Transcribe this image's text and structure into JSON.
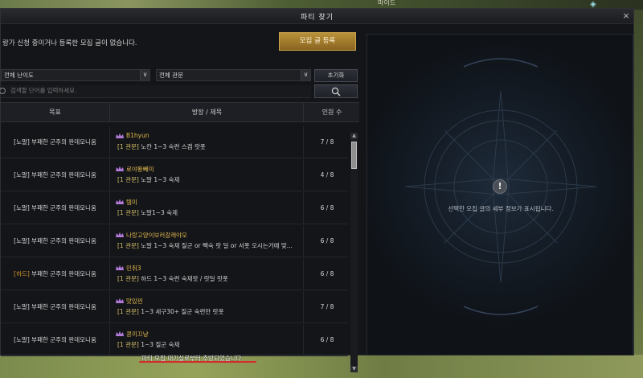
{
  "background": {
    "hint_text": "마이드"
  },
  "window": {
    "title": "파티 찾기",
    "close_icon": "×"
  },
  "notice": "랑가 신청 중이거나 등록한 모집 글이 없습니다.",
  "register_button": "모집 글 등록",
  "filters": {
    "difficulty": "전체 난이도",
    "stage": "전체 관문",
    "reset_label": "초기화"
  },
  "search": {
    "placeholder": "검색할 단어를 입력하세요."
  },
  "table": {
    "headers": {
      "goal": "목표",
      "host": "방장 / 제목",
      "count": "인원 수"
    },
    "rows": [
      {
        "goal_tag": "[노말]",
        "goal": " 부패한 군주의 판데모니움",
        "host": "B1hyun",
        "channel": "[1 관문]",
        "desc": " 노칸 1~3 숙련 스겜 랏풋",
        "count": "7 / 8"
      },
      {
        "goal_tag": "[노말]",
        "goal": " 부패한 군주의 판데모니움",
        "host": "로야퐝빼미",
        "channel": "[1 관문]",
        "desc": " 노말 1~3 숙제",
        "count": "4 / 8"
      },
      {
        "goal_tag": "[노말]",
        "goal": " 부패한 군주의 판데모니움",
        "host": "템미",
        "channel": "[1 관문]",
        "desc": " 노말1~3 숙제",
        "count": "6 / 8"
      },
      {
        "goal_tag": "[노말]",
        "goal": " 부패한 군주의 판데모니움",
        "host": "나랑고양이보러갈래야오",
        "channel": "[1 관문]",
        "desc": " 노말 1~3 숙제 질군 or 빽숙 랏 딜 or  서폿 오시는거에 맞...",
        "count": "6 / 8"
      },
      {
        "goal_tag": "[하드]",
        "goal": " 부패한 군주의 판데모니움",
        "host": "민취3",
        "channel": "[1 관문]",
        "desc": " 하드 1~3 숙련 숙제팟 / 랏딜 랏풋",
        "count": "6 / 8"
      },
      {
        "goal_tag": "[노말]",
        "goal": " 부패한 군주의 판데모니움",
        "host": "맛있찐",
        "channel": "[1 관문]",
        "desc": " 1~3 세구30+ 질군 숙련만 랏풋",
        "count": "7 / 8"
      },
      {
        "goal_tag": "[노말]",
        "goal": " 부패한 군주의 판데모니움",
        "host": "콩끼끄냥",
        "channel": "[1 관문]",
        "desc": " 1~3 질군 숙제",
        "count": "6 / 8"
      }
    ]
  },
  "toast": "파티 모집 대기실로부터 추방되었습니다.",
  "detail": {
    "icon": "!",
    "message": "선택한 모집 글의 세부 정보가 표시됩니다."
  }
}
